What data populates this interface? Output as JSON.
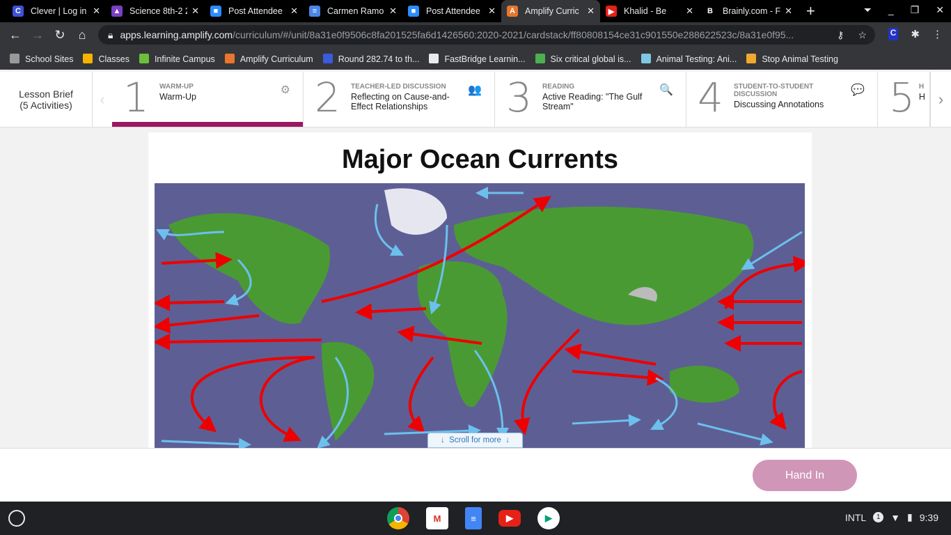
{
  "browser": {
    "tabs": [
      {
        "title": "Clever | Log in",
        "color": "#3f51d6",
        "glyph": "C"
      },
      {
        "title": "Science 8th-2 2",
        "color": "#7b3fc4",
        "glyph": "▲"
      },
      {
        "title": "Post Attendee",
        "color": "#2d8cff",
        "glyph": "■"
      },
      {
        "title": "Carmen Ramo",
        "color": "#4a86e8",
        "glyph": "≡"
      },
      {
        "title": "Post Attendee",
        "color": "#2d8cff",
        "glyph": "■"
      },
      {
        "title": "Amplify Curric",
        "color": "#e8762c",
        "glyph": "A"
      },
      {
        "title": "Khalid - Be",
        "color": "#e62117",
        "glyph": "▶"
      },
      {
        "title": "Brainly.com - F",
        "color": "#000",
        "glyph": "B"
      }
    ],
    "url_host": "apps.learning.amplify.com",
    "url_path": "/curriculum/#/unit/8a31e0f9506c8fa201525fa6d1426560:2020-2021/cardstack/ff80808154ce31c901550e288622523c/8a31e0f95...",
    "bookmarks": [
      {
        "label": "School Sites",
        "color": "#999"
      },
      {
        "label": "Classes",
        "color": "#f4b400"
      },
      {
        "label": "Infinite Campus",
        "color": "#6cbf3a"
      },
      {
        "label": "Amplify Curriculum",
        "color": "#e8762c"
      },
      {
        "label": "Round 282.74 to th...",
        "color": "#3b5bdb"
      },
      {
        "label": "FastBridge Learnin...",
        "color": "#e8eaed"
      },
      {
        "label": "Six critical global is...",
        "color": "#4caf50"
      },
      {
        "label": "Animal Testing: Ani...",
        "color": "#7ec8e3"
      },
      {
        "label": "Stop Animal Testing",
        "color": "#f0a830"
      }
    ]
  },
  "lesson": {
    "brief_title": "Lesson Brief",
    "brief_count": "(5 Activities)",
    "activities": [
      {
        "num": "1",
        "category": "WARM-UP",
        "name": "Warm-Up",
        "icon": "⚙"
      },
      {
        "num": "2",
        "category": "TEACHER-LED DISCUSSION",
        "name": "Reflecting on Cause-and-Effect Relationships",
        "icon": "👥"
      },
      {
        "num": "3",
        "category": "READING",
        "name": "Active Reading: \"The Gulf Stream\"",
        "icon": "🔍"
      },
      {
        "num": "4",
        "category": "STUDENT-TO-STUDENT DISCUSSION",
        "name": "Discussing Annotations",
        "icon": "💬"
      },
      {
        "num": "5",
        "category": "H",
        "name": "H",
        "icon": ""
      }
    ]
  },
  "content": {
    "title": "Major Ocean Currents",
    "scroll_label": "Scroll for more"
  },
  "footer": {
    "hand_in": "Hand In"
  },
  "shelf": {
    "ime": "INTL",
    "notifications": "1",
    "time": "9:39"
  }
}
